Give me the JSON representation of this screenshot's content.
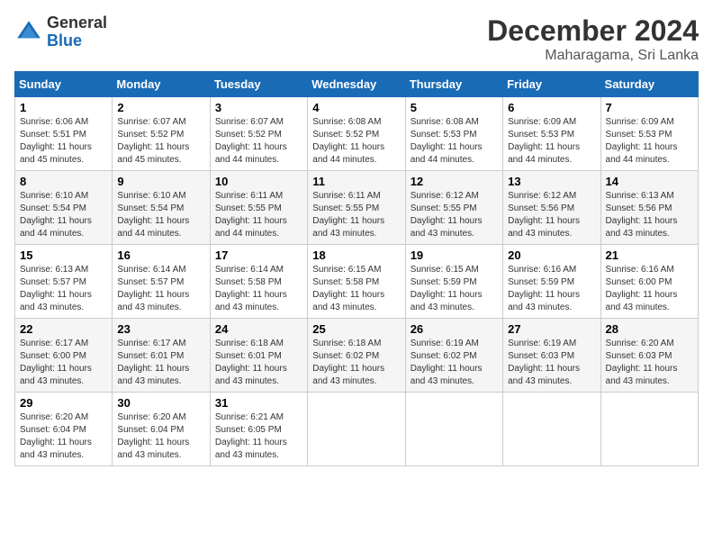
{
  "header": {
    "logo_general": "General",
    "logo_blue": "Blue",
    "month_title": "December 2024",
    "location": "Maharagama, Sri Lanka"
  },
  "calendar": {
    "days_of_week": [
      "Sunday",
      "Monday",
      "Tuesday",
      "Wednesday",
      "Thursday",
      "Friday",
      "Saturday"
    ],
    "weeks": [
      [
        {
          "day": "1",
          "sunrise": "6:06 AM",
          "sunset": "5:51 PM",
          "daylight": "11 hours and 45 minutes."
        },
        {
          "day": "2",
          "sunrise": "6:07 AM",
          "sunset": "5:52 PM",
          "daylight": "11 hours and 45 minutes."
        },
        {
          "day": "3",
          "sunrise": "6:07 AM",
          "sunset": "5:52 PM",
          "daylight": "11 hours and 44 minutes."
        },
        {
          "day": "4",
          "sunrise": "6:08 AM",
          "sunset": "5:52 PM",
          "daylight": "11 hours and 44 minutes."
        },
        {
          "day": "5",
          "sunrise": "6:08 AM",
          "sunset": "5:53 PM",
          "daylight": "11 hours and 44 minutes."
        },
        {
          "day": "6",
          "sunrise": "6:09 AM",
          "sunset": "5:53 PM",
          "daylight": "11 hours and 44 minutes."
        },
        {
          "day": "7",
          "sunrise": "6:09 AM",
          "sunset": "5:53 PM",
          "daylight": "11 hours and 44 minutes."
        }
      ],
      [
        {
          "day": "8",
          "sunrise": "6:10 AM",
          "sunset": "5:54 PM",
          "daylight": "11 hours and 44 minutes."
        },
        {
          "day": "9",
          "sunrise": "6:10 AM",
          "sunset": "5:54 PM",
          "daylight": "11 hours and 44 minutes."
        },
        {
          "day": "10",
          "sunrise": "6:11 AM",
          "sunset": "5:55 PM",
          "daylight": "11 hours and 44 minutes."
        },
        {
          "day": "11",
          "sunrise": "6:11 AM",
          "sunset": "5:55 PM",
          "daylight": "11 hours and 43 minutes."
        },
        {
          "day": "12",
          "sunrise": "6:12 AM",
          "sunset": "5:55 PM",
          "daylight": "11 hours and 43 minutes."
        },
        {
          "day": "13",
          "sunrise": "6:12 AM",
          "sunset": "5:56 PM",
          "daylight": "11 hours and 43 minutes."
        },
        {
          "day": "14",
          "sunrise": "6:13 AM",
          "sunset": "5:56 PM",
          "daylight": "11 hours and 43 minutes."
        }
      ],
      [
        {
          "day": "15",
          "sunrise": "6:13 AM",
          "sunset": "5:57 PM",
          "daylight": "11 hours and 43 minutes."
        },
        {
          "day": "16",
          "sunrise": "6:14 AM",
          "sunset": "5:57 PM",
          "daylight": "11 hours and 43 minutes."
        },
        {
          "day": "17",
          "sunrise": "6:14 AM",
          "sunset": "5:58 PM",
          "daylight": "11 hours and 43 minutes."
        },
        {
          "day": "18",
          "sunrise": "6:15 AM",
          "sunset": "5:58 PM",
          "daylight": "11 hours and 43 minutes."
        },
        {
          "day": "19",
          "sunrise": "6:15 AM",
          "sunset": "5:59 PM",
          "daylight": "11 hours and 43 minutes."
        },
        {
          "day": "20",
          "sunrise": "6:16 AM",
          "sunset": "5:59 PM",
          "daylight": "11 hours and 43 minutes."
        },
        {
          "day": "21",
          "sunrise": "6:16 AM",
          "sunset": "6:00 PM",
          "daylight": "11 hours and 43 minutes."
        }
      ],
      [
        {
          "day": "22",
          "sunrise": "6:17 AM",
          "sunset": "6:00 PM",
          "daylight": "11 hours and 43 minutes."
        },
        {
          "day": "23",
          "sunrise": "6:17 AM",
          "sunset": "6:01 PM",
          "daylight": "11 hours and 43 minutes."
        },
        {
          "day": "24",
          "sunrise": "6:18 AM",
          "sunset": "6:01 PM",
          "daylight": "11 hours and 43 minutes."
        },
        {
          "day": "25",
          "sunrise": "6:18 AM",
          "sunset": "6:02 PM",
          "daylight": "11 hours and 43 minutes."
        },
        {
          "day": "26",
          "sunrise": "6:19 AM",
          "sunset": "6:02 PM",
          "daylight": "11 hours and 43 minutes."
        },
        {
          "day": "27",
          "sunrise": "6:19 AM",
          "sunset": "6:03 PM",
          "daylight": "11 hours and 43 minutes."
        },
        {
          "day": "28",
          "sunrise": "6:20 AM",
          "sunset": "6:03 PM",
          "daylight": "11 hours and 43 minutes."
        }
      ],
      [
        {
          "day": "29",
          "sunrise": "6:20 AM",
          "sunset": "6:04 PM",
          "daylight": "11 hours and 43 minutes."
        },
        {
          "day": "30",
          "sunrise": "6:20 AM",
          "sunset": "6:04 PM",
          "daylight": "11 hours and 43 minutes."
        },
        {
          "day": "31",
          "sunrise": "6:21 AM",
          "sunset": "6:05 PM",
          "daylight": "11 hours and 43 minutes."
        },
        null,
        null,
        null,
        null
      ]
    ]
  }
}
